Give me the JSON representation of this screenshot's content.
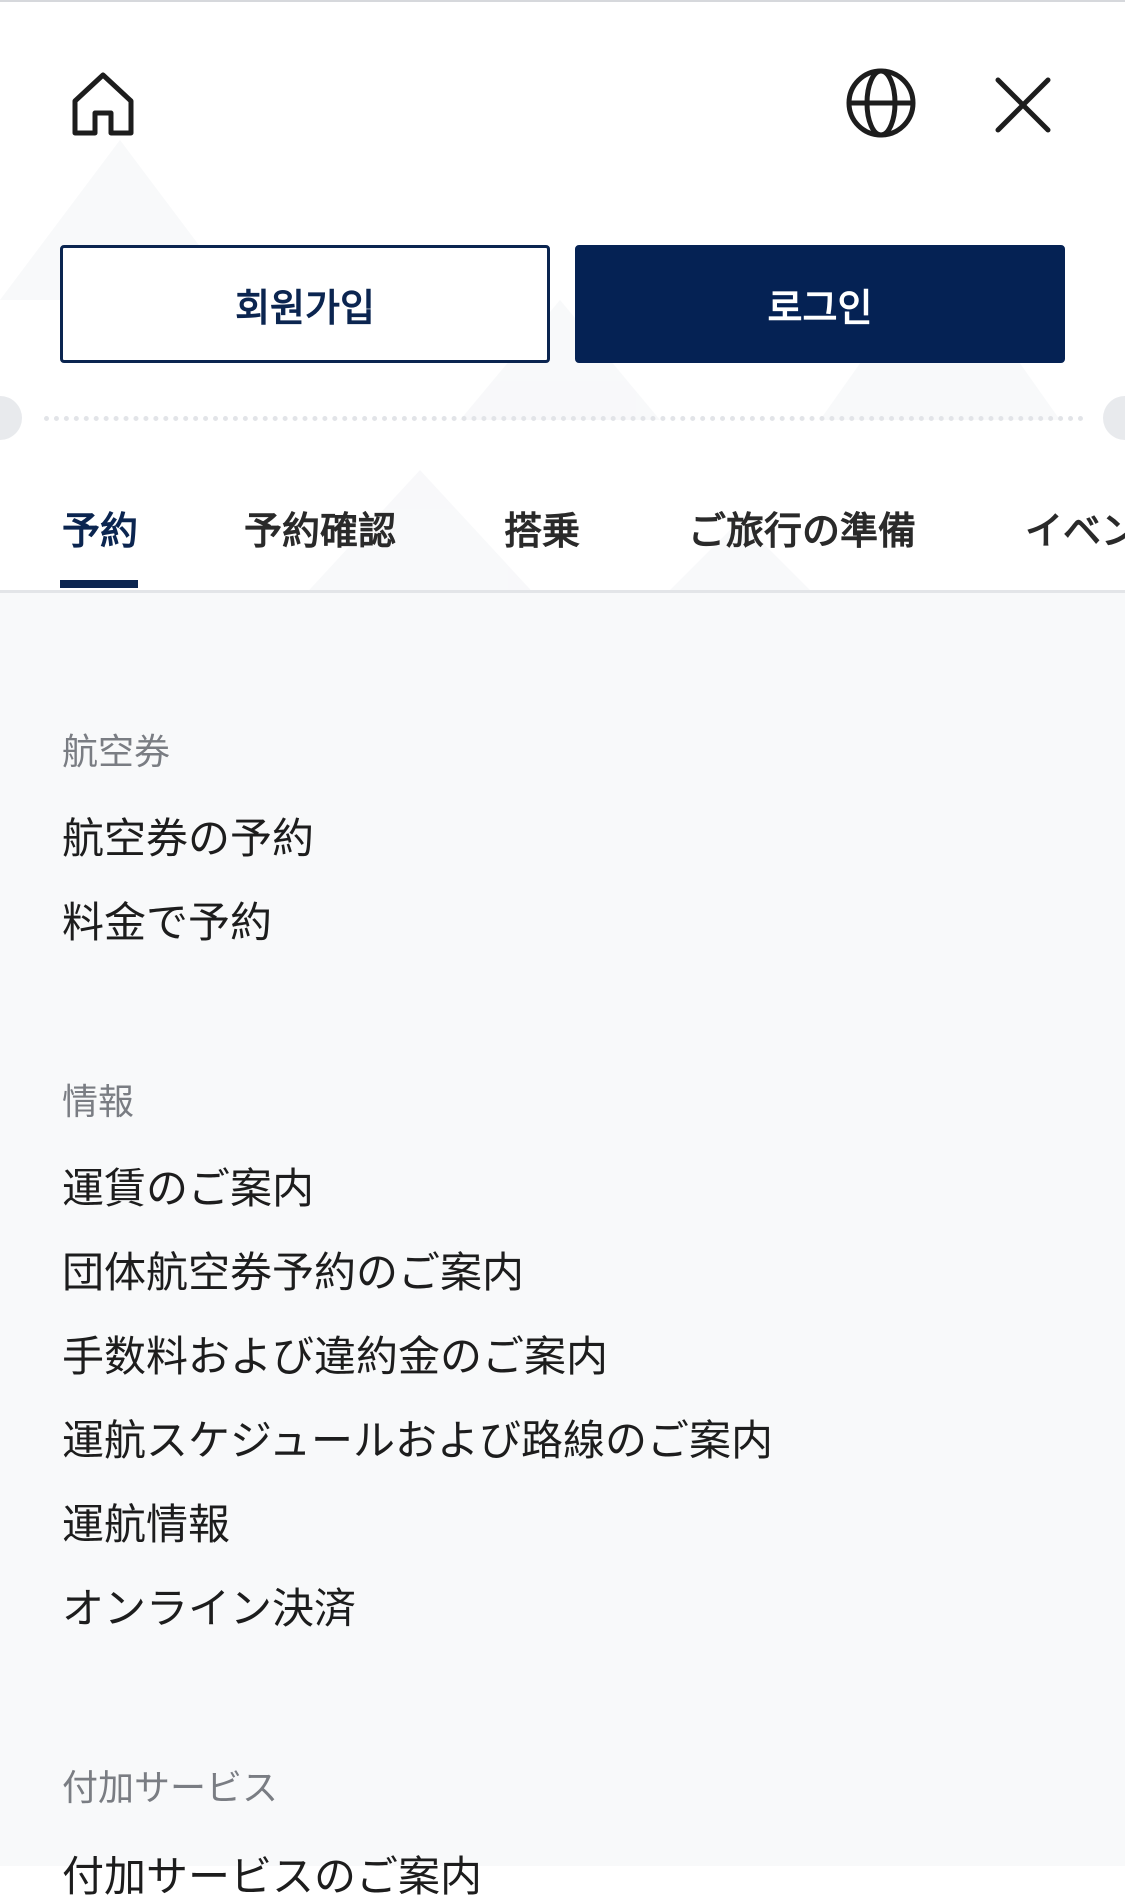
{
  "header": {
    "home_icon": "home-icon",
    "globe_icon": "globe-icon",
    "close_icon": "close-icon"
  },
  "auth": {
    "signup_label": "회원가입",
    "login_label": "로그인"
  },
  "tabs": [
    {
      "label": "予約",
      "active": true
    },
    {
      "label": "予約確認",
      "active": false
    },
    {
      "label": "搭乗",
      "active": false
    },
    {
      "label": "ご旅行の準備",
      "active": false
    },
    {
      "label": "イベン",
      "active": false
    }
  ],
  "sections": [
    {
      "heading": "航空券",
      "links": [
        "航空券の予約",
        "料金で予約"
      ]
    },
    {
      "heading": "情報",
      "links": [
        "運賃のご案内",
        "団体航空券予約のご案内",
        "手数料および違約金のご案内",
        "運航スケジュールおよび路線のご案内",
        "運航情報",
        "オンライン決済"
      ]
    },
    {
      "heading": "付加サービス",
      "links": [
        "付加サービスのご案内"
      ]
    }
  ],
  "colors": {
    "primary": "#052254",
    "heading_gray": "#7a7d83",
    "content_bg": "#f8f9fa"
  }
}
